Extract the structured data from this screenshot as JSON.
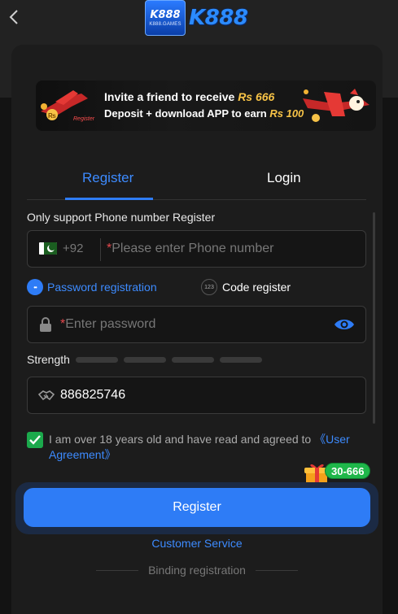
{
  "header": {
    "logo_badge": "K888",
    "logo_badge_sub": "K888.GAMES",
    "logo_text": "K888"
  },
  "banner": {
    "line1_text": "Invite a friend to receive",
    "line1_amount": "Rs 666",
    "line2_text": "Deposit + download APP to earn",
    "line2_amount": "Rs 100",
    "register_tag": "Register"
  },
  "tabs": [
    {
      "label": "Register",
      "active": true
    },
    {
      "label": "Login",
      "active": false
    }
  ],
  "form": {
    "note": "Only support Phone number Register",
    "phone": {
      "country_code": "+92",
      "required_mark": "*",
      "placeholder": "Please enter Phone number"
    },
    "modes": [
      {
        "label": "Password registration",
        "active": true,
        "icon": "password-dots-icon"
      },
      {
        "label": "Code register",
        "active": false,
        "icon": "code-123-icon"
      }
    ],
    "code_icon_text": "123",
    "password": {
      "required_mark": "*",
      "placeholder": "Enter password"
    },
    "strength_label": "Strength",
    "invite_code": "886825746",
    "agreement": {
      "text": "I am over 18 years old and have read and agreed to ",
      "link": "《User Agreement》",
      "checked": true
    },
    "gift_badge": "30-666",
    "register_button": "Register",
    "customer_service": "Customer Service",
    "binding_label": "Binding registration"
  },
  "colors": {
    "accent": "#2e7cf6",
    "check": "#1ba94c",
    "required": "#e5484d",
    "gold": "#f7c347"
  }
}
